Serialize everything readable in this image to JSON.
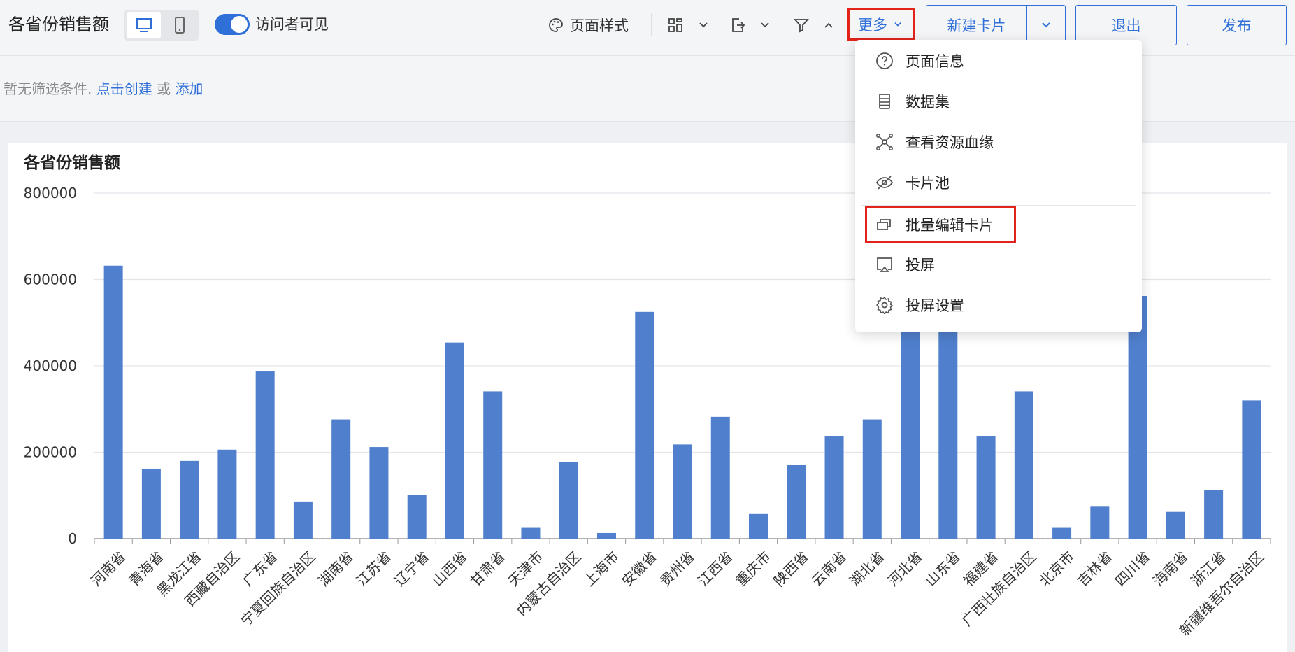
{
  "header": {
    "title": "各省份销售额",
    "visitor_visible": "访问者可见",
    "page_style": "页面样式",
    "more": "更多",
    "new_card": "新建卡片",
    "exit": "退出",
    "publish": "发布"
  },
  "filter": {
    "empty_text": "暂无筛选条件.",
    "create_link": "点击创建",
    "or": "或",
    "add_link": "添加"
  },
  "menu": {
    "items": [
      {
        "label": "页面信息",
        "icon": "question-circle-icon"
      },
      {
        "label": "数据集",
        "icon": "dataset-icon"
      },
      {
        "label": "查看资源血缘",
        "icon": "lineage-icon"
      },
      {
        "label": "卡片池",
        "icon": "eye-off-icon"
      },
      {
        "label": "批量编辑卡片",
        "icon": "batch-edit-icon"
      },
      {
        "label": "投屏",
        "icon": "cast-icon"
      },
      {
        "label": "投屏设置",
        "icon": "gear-icon"
      }
    ]
  },
  "colors": {
    "accent": "#2f6fd8",
    "bar": "#4f7fcd",
    "highlight": "#e2231a"
  },
  "chart_data": {
    "type": "bar",
    "title": "各省份销售额",
    "ylim": [
      0,
      800000
    ],
    "yticks": [
      "800000",
      "600000",
      "400000",
      "200000",
      "0"
    ],
    "grid": true,
    "categories": [
      "河南省",
      "青海省",
      "黑龙江省",
      "西藏自治区",
      "广东省",
      "宁夏回族自治区",
      "湖南省",
      "江苏省",
      "辽宁省",
      "山西省",
      "甘肃省",
      "天津市",
      "内蒙古自治区",
      "上海市",
      "安徽省",
      "贵州省",
      "江西省",
      "重庆市",
      "陕西省",
      "云南省",
      "湖北省",
      "河北省",
      "山东省",
      "福建省",
      "广西壮族自治区",
      "北京市",
      "吉林省",
      "四川省",
      "海南省",
      "浙江省",
      "新疆维吾尔自治区"
    ],
    "values": [
      632000,
      162000,
      180000,
      206000,
      387000,
      86000,
      276000,
      212000,
      101000,
      454000,
      341000,
      25000,
      177000,
      13000,
      525000,
      218000,
      282000,
      57000,
      171000,
      238000,
      276000,
      480000,
      480000,
      238000,
      341000,
      25000,
      74000,
      562000,
      62000,
      112000,
      320000
    ]
  }
}
